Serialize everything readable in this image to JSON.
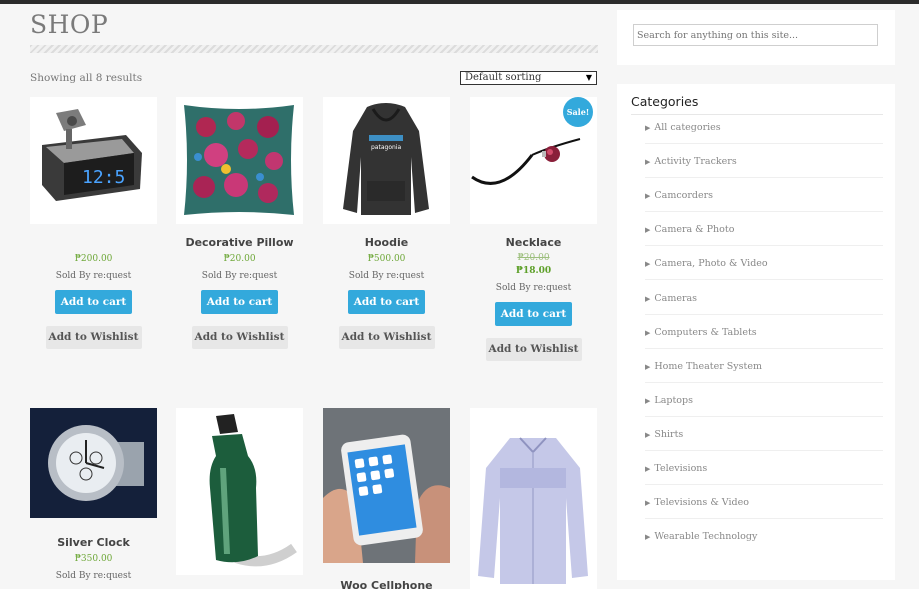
{
  "shop": {
    "title": "SHOP",
    "result_count": "Showing all 8 results",
    "sort_selected": "Default sorting"
  },
  "products": [
    {
      "name": "",
      "price": "₱200.00",
      "sold_by": "Sold By re:quest",
      "cart_label": "Add to cart",
      "wishlist_label": "Add to Wishlist"
    },
    {
      "name": "Decorative Pillow",
      "price": "₱20.00",
      "sold_by": "Sold By re:quest",
      "cart_label": "Add to cart",
      "wishlist_label": "Add to Wishlist"
    },
    {
      "name": "Hoodie",
      "price": "₱500.00",
      "sold_by": "Sold By re:quest",
      "cart_label": "Add to cart",
      "wishlist_label": "Add to Wishlist"
    },
    {
      "name": "Necklace",
      "price_old": "₱20.00",
      "price": "₱18.00",
      "sale_badge": "Sale!",
      "sold_by": "Sold By re:quest",
      "cart_label": "Add to cart",
      "wishlist_label": "Add to Wishlist"
    },
    {
      "name": "Silver Clock",
      "price": "₱350.00",
      "sold_by": "Sold By re:quest"
    },
    {
      "name": ""
    },
    {
      "name": "Woo Cellphone"
    },
    {
      "name": ""
    }
  ],
  "sidebar": {
    "search_placeholder": "Search for anything on this site...",
    "categories_title": "Categories",
    "categories": [
      "All categories",
      "Activity Trackers",
      "Camcorders",
      "Camera & Photo",
      "Camera, Photo & Video",
      "Cameras",
      "Computers & Tablets",
      "Home Theater System",
      "Laptops",
      "Shirts",
      "Televisions",
      "Televisions & Video",
      "Wearable Technology"
    ]
  },
  "colors": {
    "accent": "#33a9dc",
    "price": "#6fa83a",
    "background": "#f6f6f6"
  }
}
